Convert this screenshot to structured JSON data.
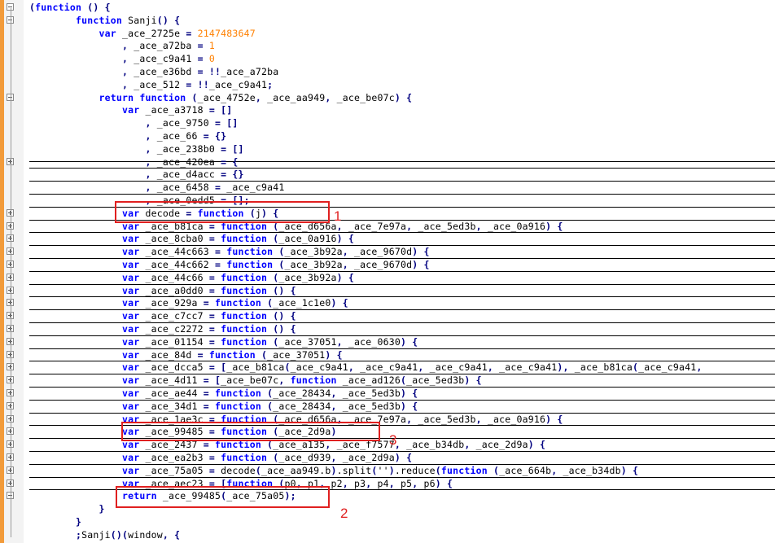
{
  "lines": [
    "(function () {",
    "        function Sanji() {",
    "            var _ace_2725e = 2147483647",
    "                , _ace_a72ba = 1",
    "                , _ace_c9a41 = 0",
    "                , _ace_e36bd = !!_ace_a72ba",
    "                , _ace_512 = !!_ace_c9a41;",
    "            return function (_ace_4752e, _ace_aa949, _ace_be07c) {",
    "                var _ace_a3718 = []",
    "                    , _ace_9750 = []",
    "                    , _ace_66 = {}",
    "                    , _ace_238b0 = []",
    "                    , _ace_420ea = {",
    "                    , _ace_d4acc = {}",
    "                    , _ace_6458 = _ace_c9a41",
    "                    , _ace_0edd5 = [];",
    "                var decode = function (j) {",
    "                var _ace_b81ca = function (_ace_d656a, _ace_7e97a, _ace_5ed3b, _ace_0a916) {",
    "                var _ace_8cba0 = function (_ace_0a916) {",
    "                var _ace_44c663 = function (_ace_3b92a, _ace_9670d) {",
    "                var _ace_44c662 = function (_ace_3b92a, _ace_9670d) {",
    "                var _ace_44c66 = function (_ace_3b92a) {",
    "                var _ace_a0dd0 = function () {",
    "                var _ace_929a = function (_ace_1c1e0) {",
    "                var _ace_c7cc7 = function () {",
    "                var _ace_c2272 = function () {",
    "                var _ace_01154 = function (_ace_37051, _ace_0630) {",
    "                var _ace_84d = function (_ace_37051) {",
    "                var _ace_dcca5 = [_ace_b81ca(_ace_c9a41, _ace_c9a41, _ace_c9a41, _ace_c9a41), _ace_b81ca(_ace_c9a41,",
    "                var _ace_4d11 = [_ace_be07c, function _ace_ad126(_ace_5ed3b) {",
    "                var _ace_ae44 = function (_ace_28434, _ace_5ed3b) {",
    "                var _ace_34d1 = function (_ace_28434, _ace_5ed3b) {",
    "                var _ace_1ae3c = function (_ace_d656a, _ace_7e97a, _ace_5ed3b, _ace_0a916) {",
    "                var _ace_99485 = function (_ace_2d9a)",
    "                var _ace_2437 = function (_ace_a135, _ace_f7577, _ace_b34db, _ace_2d9a) {",
    "                var _ace_ea2b3 = function (_ace_d939, _ace_2d9a) {",
    "                var _ace_75a05 = decode(_ace_aa949.b).split('').reduce(function (_ace_664b, _ace_b34db) {",
    "                var _ace_aec23 = [function (p0, p1, p2, p3, p4, p5, p6) {",
    "                return _ace_99485(_ace_75a05);",
    "            }",
    "        }",
    "        ;Sanji()(window, {"
  ],
  "annotations": [
    "1",
    "3",
    "2"
  ]
}
